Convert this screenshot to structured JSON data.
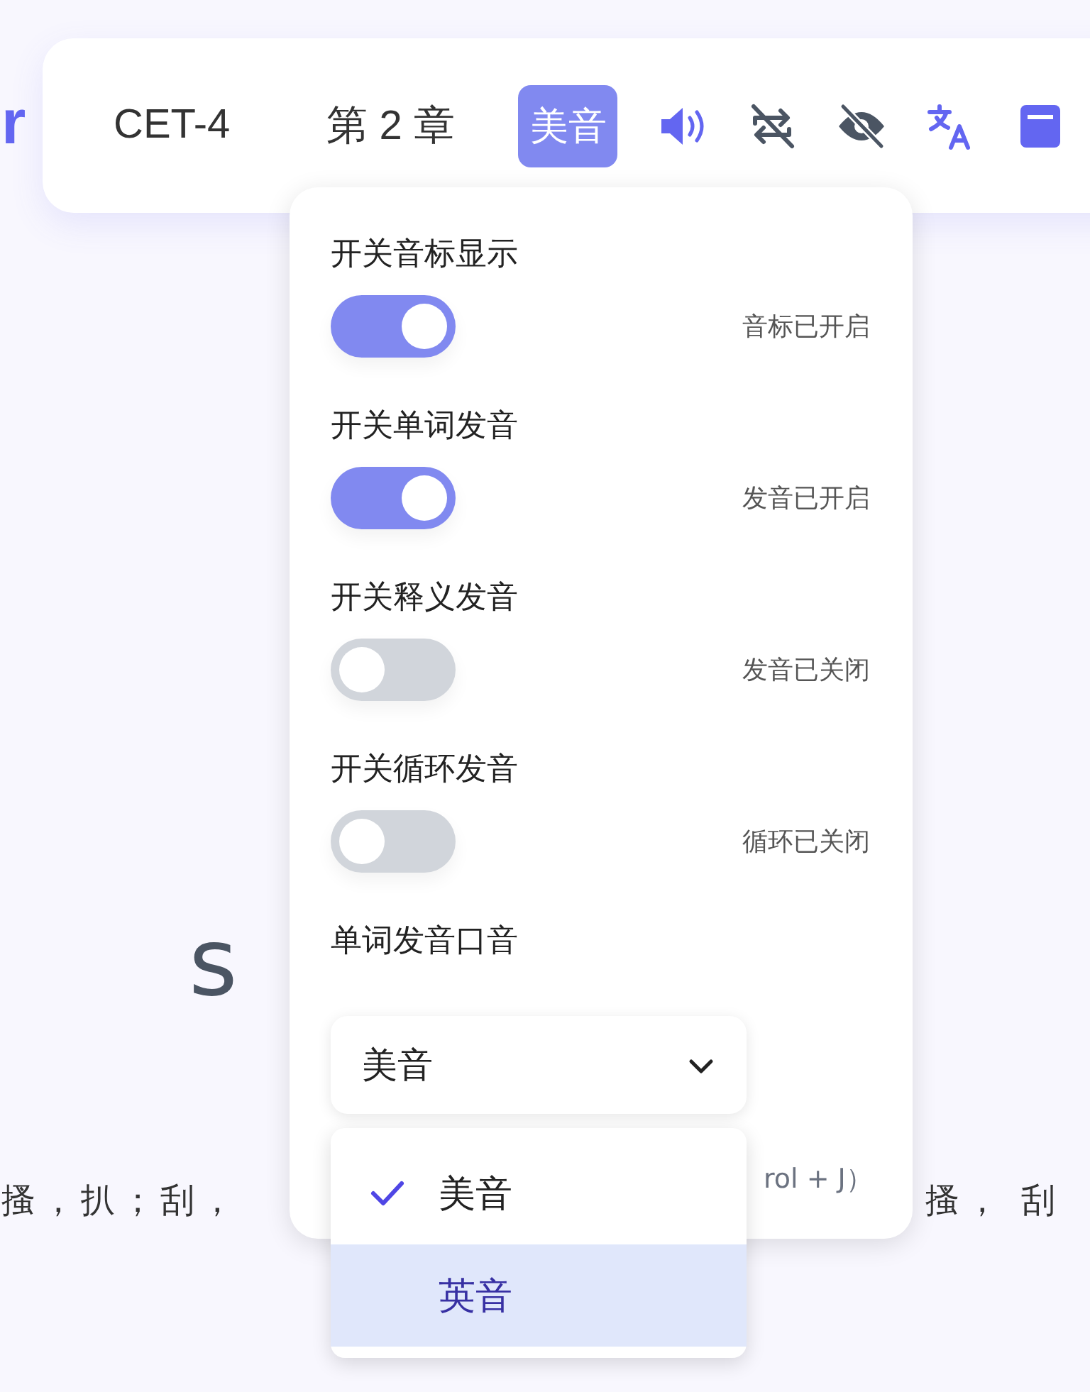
{
  "logo_fragment": "r",
  "toolbar": {
    "dictionary": "CET-4",
    "chapter": "第 2 章",
    "accent_button": {
      "label": "美音",
      "active": true
    },
    "icons": [
      {
        "kind": "speaker",
        "active": true
      },
      {
        "kind": "loop",
        "active": false
      },
      {
        "kind": "eye",
        "active": false
      },
      {
        "kind": "translate",
        "active": true
      },
      {
        "kind": "book",
        "active": true
      }
    ]
  },
  "word": "s",
  "translation_left": "搔，扒；刮，",
  "translation_right": "搔， 刮",
  "hint_fragment": "rol + J）",
  "settings_panel": {
    "toggles": [
      {
        "label": "开关音标显示",
        "on": true,
        "status": "音标已开启"
      },
      {
        "label": "开关单词发音",
        "on": true,
        "status": "发音已开启"
      },
      {
        "label": "开关释义发音",
        "on": false,
        "status": "发音已关闭"
      },
      {
        "label": "开关循环发音",
        "on": false,
        "status": "循环已关闭"
      }
    ],
    "accent_label": "单词发音口音",
    "accent_select": {
      "value": "美音",
      "options": [
        {
          "label": "美音",
          "selected": true,
          "highlighted": false
        },
        {
          "label": "英音",
          "selected": false,
          "highlighted": true
        }
      ]
    }
  }
}
